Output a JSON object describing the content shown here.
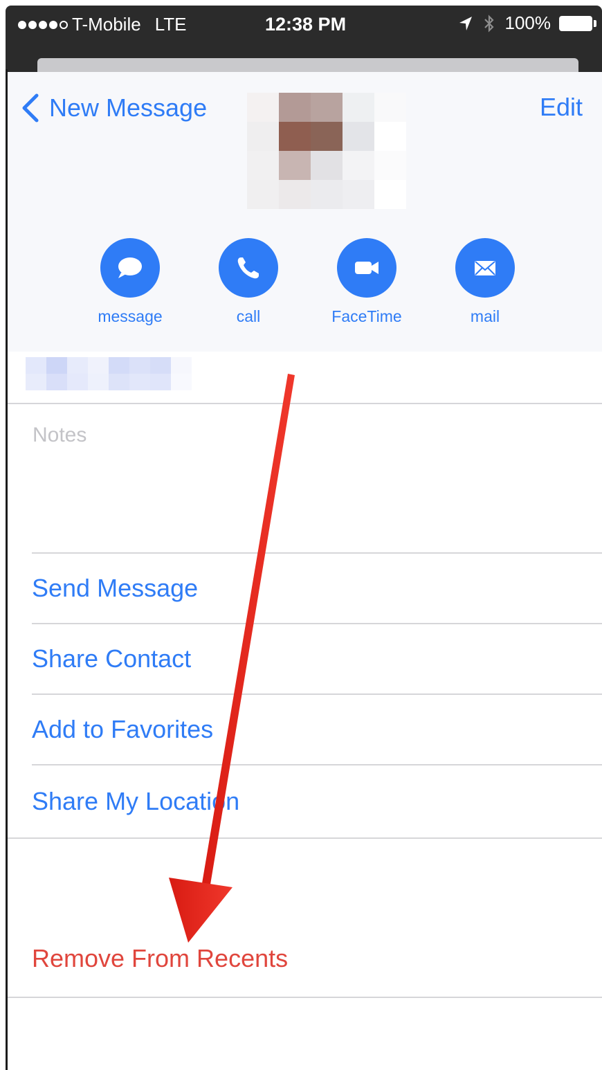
{
  "status_bar": {
    "carrier": "T-Mobile",
    "network": "LTE",
    "time": "12:38 PM",
    "battery": "100%"
  },
  "nav": {
    "back_label": "New Message",
    "edit_label": "Edit"
  },
  "actions": [
    {
      "label": "message",
      "icon": "speech-bubble-icon"
    },
    {
      "label": "call",
      "icon": "phone-icon"
    },
    {
      "label": "FaceTime",
      "icon": "video-camera-icon"
    },
    {
      "label": "mail",
      "icon": "envelope-icon"
    }
  ],
  "notes": {
    "label": "Notes"
  },
  "menu": [
    {
      "label": "Send Message"
    },
    {
      "label": "Share Contact"
    },
    {
      "label": "Add to Favorites"
    },
    {
      "label": "Share My Location"
    }
  ],
  "remove": {
    "label": "Remove From Recents"
  },
  "colors": {
    "accent": "#2f7cf6",
    "destructive": "#e0463d",
    "annotation_arrow": "#e8281e",
    "status_bar_bg": "#2b2b2b"
  }
}
